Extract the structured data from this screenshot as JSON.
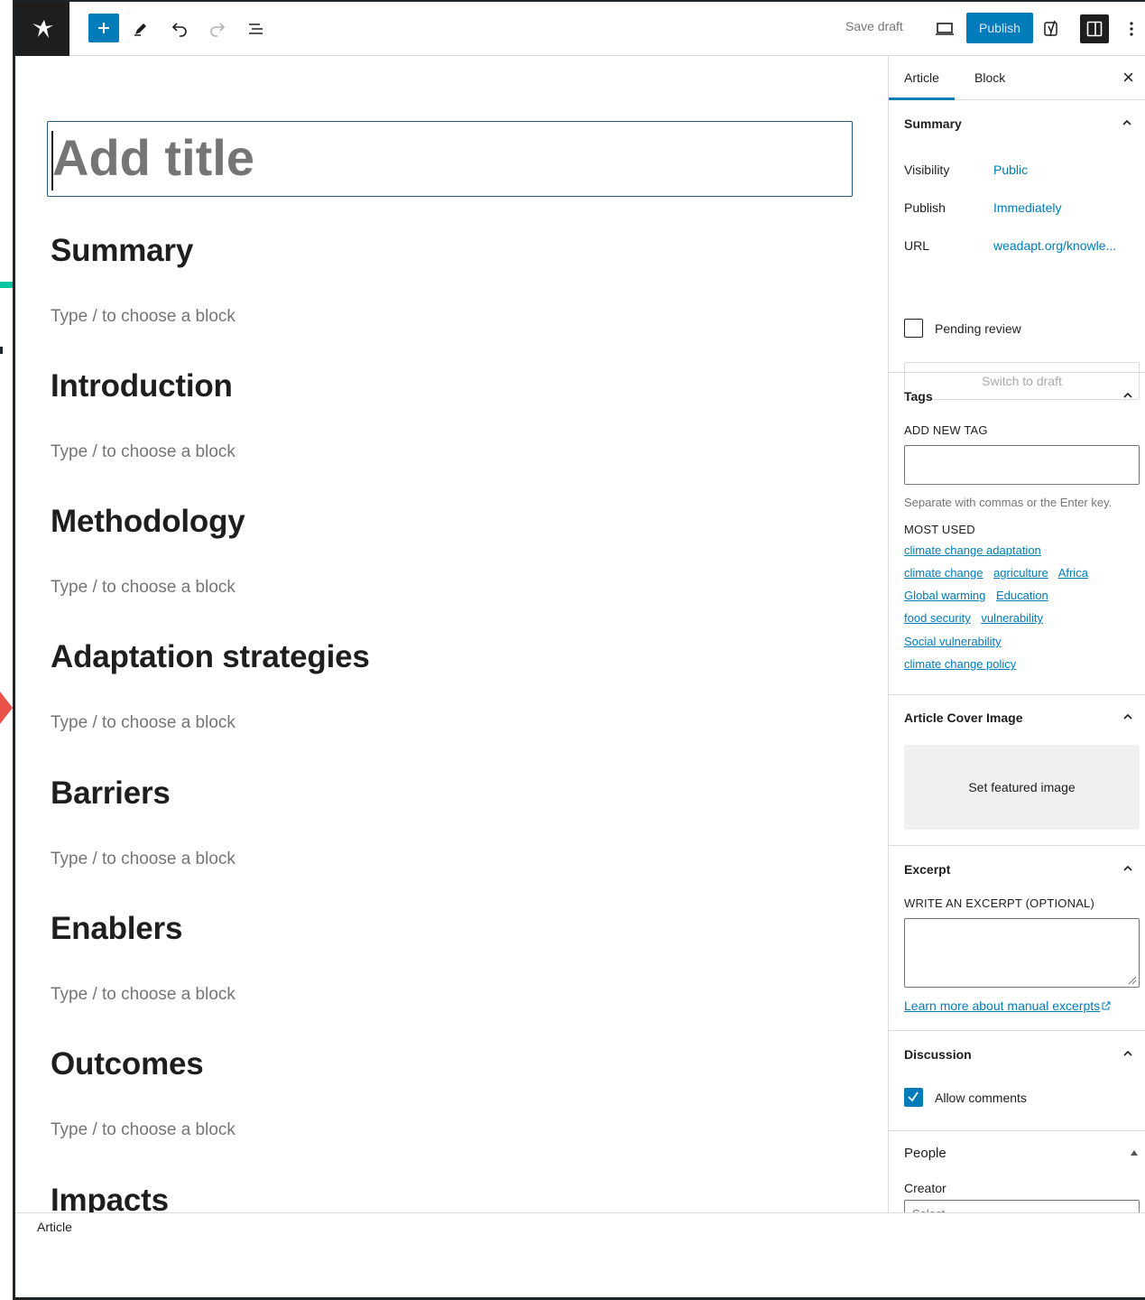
{
  "toolbar": {
    "save_draft": "Save draft",
    "publish": "Publish"
  },
  "editor": {
    "title_placeholder": "Add title",
    "block_placeholder": "Type / to choose a block",
    "sections": [
      {
        "heading": "Summary"
      },
      {
        "heading": "Introduction"
      },
      {
        "heading": "Methodology"
      },
      {
        "heading": "Adaptation strategies"
      },
      {
        "heading": "Barriers"
      },
      {
        "heading": "Enablers"
      },
      {
        "heading": "Outcomes"
      },
      {
        "heading": "Impacts"
      }
    ]
  },
  "sidebar": {
    "tabs": [
      "Article",
      "Block"
    ],
    "summary": {
      "title": "Summary",
      "visibility_label": "Visibility",
      "visibility_value": "Public",
      "publish_label": "Publish",
      "publish_value": "Immediately",
      "url_label": "URL",
      "url_value": "weadapt.org/knowle...",
      "pending_review": "Pending review",
      "switch_to_draft": "Switch to draft"
    },
    "tags": {
      "title": "Tags",
      "add_new_tag": "ADD NEW TAG",
      "help": "Separate with commas or the Enter key.",
      "most_used": "MOST USED",
      "lines": [
        [
          "climate change adaptation"
        ],
        [
          "climate change",
          "agriculture",
          "Africa"
        ],
        [
          "Global warming",
          "Education"
        ],
        [
          "food security",
          "vulnerability"
        ],
        [
          "Social vulnerability"
        ],
        [
          "climate change policy"
        ]
      ]
    },
    "cover": {
      "title": "Article Cover Image",
      "button": "Set featured image"
    },
    "excerpt": {
      "title": "Excerpt",
      "label": "WRITE AN EXCERPT (OPTIONAL)",
      "learn_more": "Learn more about manual excerpts"
    },
    "discussion": {
      "title": "Discussion",
      "allow_comments": "Allow comments"
    },
    "people": {
      "title": "People",
      "creator_label": "Creator",
      "select_placeholder": "Select"
    }
  },
  "footer": {
    "breadcrumb": "Article"
  },
  "colors": {
    "accent": "#007cba",
    "dark": "#1e1e1e"
  }
}
